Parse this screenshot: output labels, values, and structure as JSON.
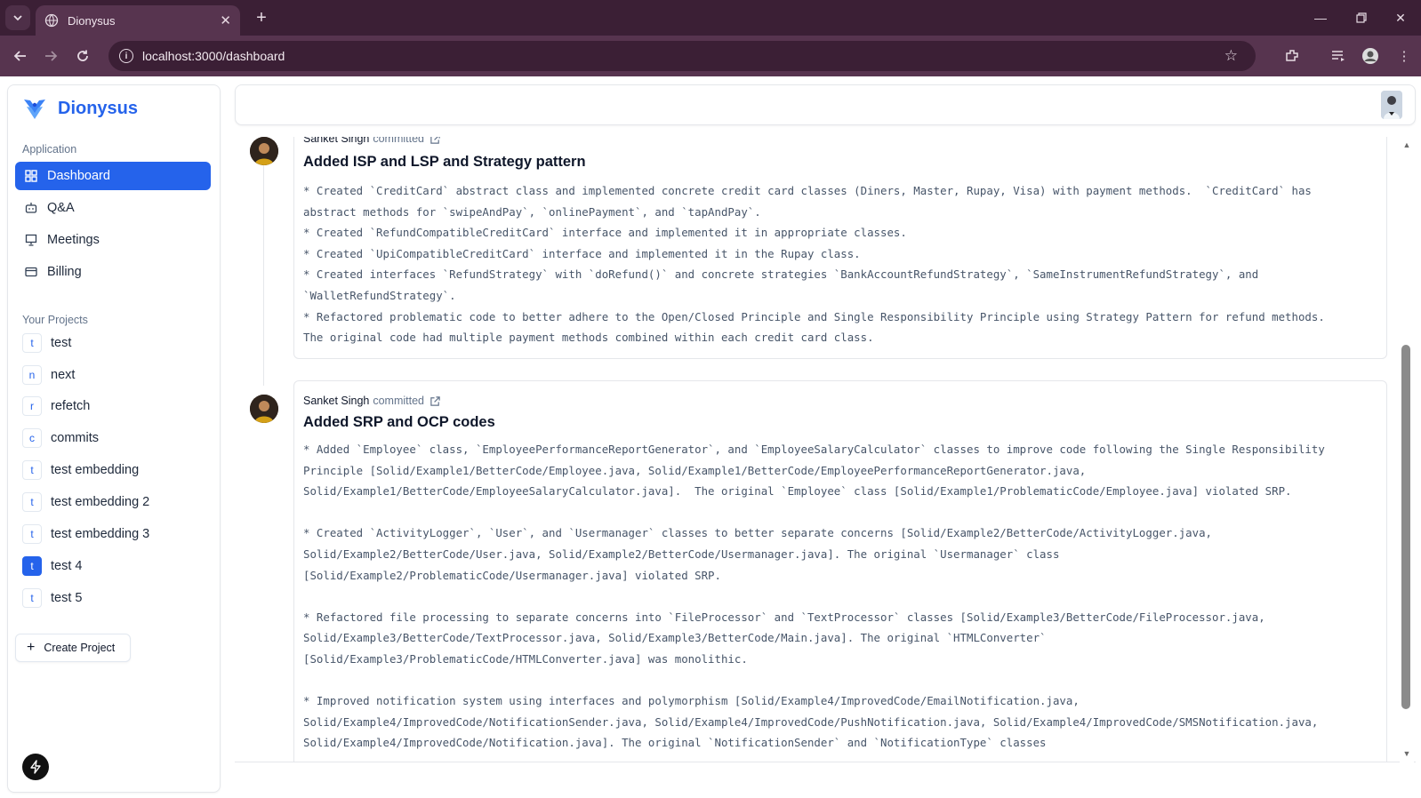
{
  "browser": {
    "tab_title": "Dionysus",
    "url": "localhost:3000/dashboard"
  },
  "sidebar": {
    "brand": "Dionysus",
    "application_label": "Application",
    "nav": [
      {
        "label": "Dashboard",
        "icon": "dashboard-icon",
        "active": true
      },
      {
        "label": "Q&A",
        "icon": "bot-icon"
      },
      {
        "label": "Meetings",
        "icon": "presentation-icon"
      },
      {
        "label": "Billing",
        "icon": "credit-card-icon"
      }
    ],
    "projects_label": "Your Projects",
    "projects": [
      {
        "letter": "t",
        "name": "test"
      },
      {
        "letter": "n",
        "name": "next"
      },
      {
        "letter": "r",
        "name": "refetch"
      },
      {
        "letter": "c",
        "name": "commits"
      },
      {
        "letter": "t",
        "name": "test embedding"
      },
      {
        "letter": "t",
        "name": "test embedding 2"
      },
      {
        "letter": "t",
        "name": "test embedding 3"
      },
      {
        "letter": "t",
        "name": "test 4",
        "selected": true
      },
      {
        "letter": "t",
        "name": "test 5"
      }
    ],
    "create_label": "Create Project"
  },
  "commits": [
    {
      "author": "Sanket Singh",
      "action": "committed",
      "title": "Added ISP and LSP and Strategy pattern",
      "body": "* Created `CreditCard` abstract class and implemented concrete credit card classes (Diners, Master, Rupay, Visa) with payment methods.  `CreditCard` has\nabstract methods for `swipeAndPay`, `onlinePayment`, and `tapAndPay`.\n* Created `RefundCompatibleCreditCard` interface and implemented it in appropriate classes.\n* Created `UpiCompatibleCreditCard` interface and implemented it in the Rupay class.\n* Created interfaces `RefundStrategy` with `doRefund()` and concrete strategies `BankAccountRefundStrategy`, `SameInstrumentRefundStrategy`, and\n`WalletRefundStrategy`.\n* Refactored problematic code to better adhere to the Open/Closed Principle and Single Responsibility Principle using Strategy Pattern for refund methods.\nThe original code had multiple payment methods combined within each credit card class."
    },
    {
      "author": "Sanket Singh",
      "action": "committed",
      "title": "Added SRP and OCP codes",
      "body": "* Added `Employee` class, `EmployeePerformanceReportGenerator`, and `EmployeeSalaryCalculator` classes to improve code following the Single Responsibility\nPrinciple [Solid/Example1/BetterCode/Employee.java, Solid/Example1/BetterCode/EmployeePerformanceReportGenerator.java,\nSolid/Example1/BetterCode/EmployeeSalaryCalculator.java].  The original `Employee` class [Solid/Example1/ProblematicCode/Employee.java] violated SRP.\n\n* Created `ActivityLogger`, `User`, and `Usermanager` classes to better separate concerns [Solid/Example2/BetterCode/ActivityLogger.java,\nSolid/Example2/BetterCode/User.java, Solid/Example2/BetterCode/Usermanager.java]. The original `Usermanager` class\n[Solid/Example2/ProblematicCode/Usermanager.java] violated SRP.\n\n* Refactored file processing to separate concerns into `FileProcessor` and `TextProcessor` classes [Solid/Example3/BetterCode/FileProcessor.java,\nSolid/Example3/BetterCode/TextProcessor.java, Solid/Example3/BetterCode/Main.java]. The original `HTMLConverter`\n[Solid/Example3/ProblematicCode/HTMLConverter.java] was monolithic.\n\n* Improved notification system using interfaces and polymorphism [Solid/Example4/ImprovedCode/EmailNotification.java,\nSolid/Example4/ImprovedCode/NotificationSender.java, Solid/Example4/ImprovedCode/PushNotification.java, Solid/Example4/ImprovedCode/SMSNotification.java,\nSolid/Example4/ImprovedCode/Notification.java]. The original `NotificationSender` and `NotificationType` classes"
    }
  ],
  "colors": {
    "accent": "#2563eb",
    "browser_frame": "#3b1f35",
    "browser_toolbar": "#57344f"
  }
}
